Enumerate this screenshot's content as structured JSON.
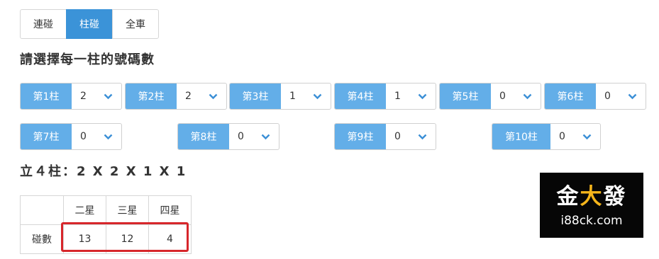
{
  "tabs": [
    {
      "label": "連碰",
      "active": false
    },
    {
      "label": "柱碰",
      "active": true
    },
    {
      "label": "全車",
      "active": false
    }
  ],
  "heading": "請選擇每一柱的號碼數",
  "columns": [
    {
      "label": "第1柱",
      "value": "2"
    },
    {
      "label": "第2柱",
      "value": "2"
    },
    {
      "label": "第3柱",
      "value": "1"
    },
    {
      "label": "第4柱",
      "value": "1"
    },
    {
      "label": "第5柱",
      "value": "0"
    },
    {
      "label": "第6柱",
      "value": "0"
    },
    {
      "label": "第7柱",
      "value": "0"
    },
    {
      "label": "第8柱",
      "value": "0"
    },
    {
      "label": "第9柱",
      "value": "0"
    },
    {
      "label": "第10柱",
      "value": "0"
    }
  ],
  "formula": "立４柱：2 X 2 X 1 X 1",
  "results": {
    "headers": [
      "",
      "二星",
      "三星",
      "四星"
    ],
    "row_label": "碰數",
    "values": [
      "13",
      "12",
      "4"
    ]
  },
  "watermark": {
    "char1": "金",
    "char2": "大",
    "char3": "發",
    "url": "i88ck.com"
  },
  "colors": {
    "accent": "#3b93d8",
    "label_bg": "#63aee8",
    "highlight": "#d7262b"
  }
}
